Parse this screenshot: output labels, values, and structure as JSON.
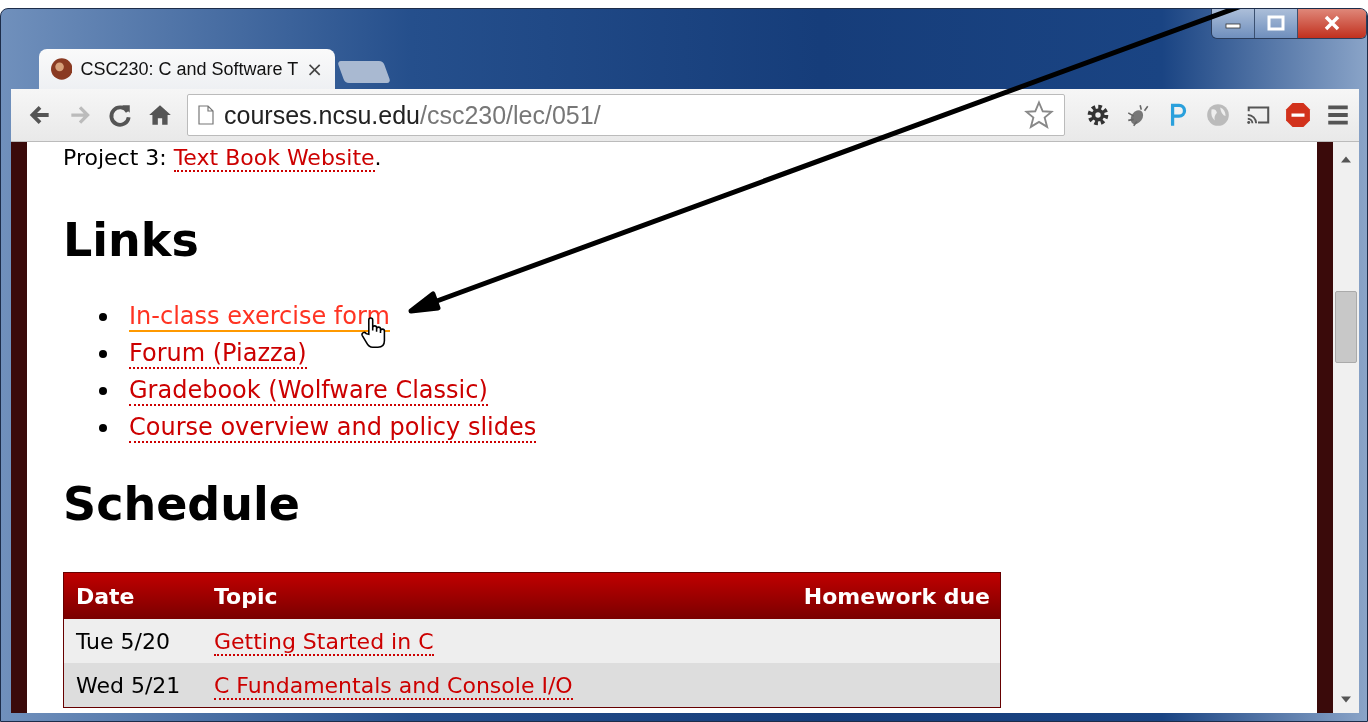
{
  "tabs": [
    {
      "title": "CSC230: C and Software T",
      "close": "×",
      "selected": true
    },
    {
      "selected": false
    }
  ],
  "address": {
    "host": "courses.ncsu.edu",
    "path": "/csc230/lec/051/"
  },
  "intro": {
    "text": "Project 3:",
    "link": "Text Book Website",
    "end": "."
  },
  "links_heading": "Links",
  "links": [
    {
      "label": "In-class exercise form",
      "hovered": true
    },
    {
      "label": "Forum (Piazza)",
      "hovered": false
    },
    {
      "label": "Gradebook (Wolfware Classic)",
      "hovered": false
    },
    {
      "label": "Course overview and policy slides",
      "hovered": false
    }
  ],
  "schedule_heading": "Schedule",
  "table": {
    "columns": [
      "Date",
      "Topic",
      "Homework due"
    ],
    "rows": [
      {
        "date": "Tue 5/20",
        "topic": "Getting Started in C"
      },
      {
        "date": "Wed 5/21",
        "topic": "C Fundamentals and Console I/O"
      }
    ]
  }
}
